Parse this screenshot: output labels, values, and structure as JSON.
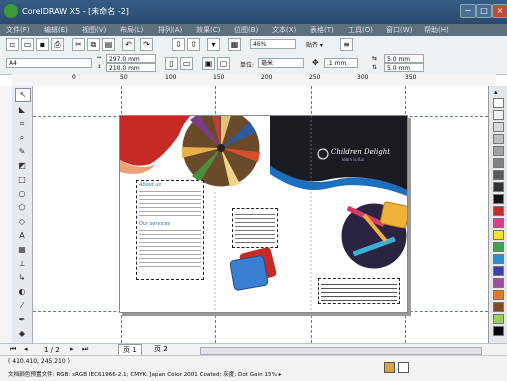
{
  "window": {
    "title": "CorelDRAW X5 - [未命名 -2]",
    "buttons": [
      "−",
      "□",
      "×"
    ]
  },
  "menu": [
    "文件(F)",
    "编辑(E)",
    "视图(V)",
    "布局(L)",
    "排列(A)",
    "效果(C)",
    "位图(B)",
    "文本(X)",
    "表格(T)",
    "工具(O)",
    "窗口(W)",
    "帮助(H)"
  ],
  "toolbar": {
    "zoom_value": "46%",
    "snap_label": "贴齐 ▾"
  },
  "property_bar": {
    "paper_size": "A4",
    "width_value": "297.0 mm",
    "height_value": "210.0 mm",
    "units_label": "单位:",
    "units_value": "毫米",
    "nudge_value": ".1 mm",
    "dup_x_value": "5.0 mm",
    "dup_y_value": "5.0 mm"
  },
  "ruler": {
    "ticks": [
      "0",
      "50",
      "100",
      "150",
      "200",
      "250",
      "300",
      "350"
    ]
  },
  "document": {
    "heading_text": "Children Delight",
    "heading_sub": "learn is fun",
    "left_title_1": "About us",
    "left_title_2": "Our services"
  },
  "page_tabs": {
    "page_count": "1 / 2",
    "tab_1": "页 1",
    "tab_2": "页 2"
  },
  "status": {
    "coords": "( 410.410, 245.210 )",
    "color_info": "文档颜色预置文件: RGB: sRGB IEC61966-2.1; CMYK: Japan Color 2001 Coated; 灰度: Dot Gain 15% ▸"
  },
  "colors": {
    "titlebar": "#2f5479",
    "accent_red": "#c62a25",
    "accent_blue": "#1d6fbf",
    "accent_yellow": "#f0b23a",
    "dark_panel": "#1b1b22"
  },
  "palette": [
    "#ffffff",
    "#f0f0f0",
    "#d8d8d8",
    "#bfbfbf",
    "#a0a0a0",
    "#808080",
    "#5a5a5a",
    "#333333",
    "#111111",
    "#c62a25",
    "#e33a8c",
    "#f5e12b",
    "#3ca548",
    "#2b8fd0",
    "#3a3fae",
    "#a24aa8",
    "#e07a25",
    "#7f4b1f",
    "#9ccf5a",
    "#000000"
  ]
}
